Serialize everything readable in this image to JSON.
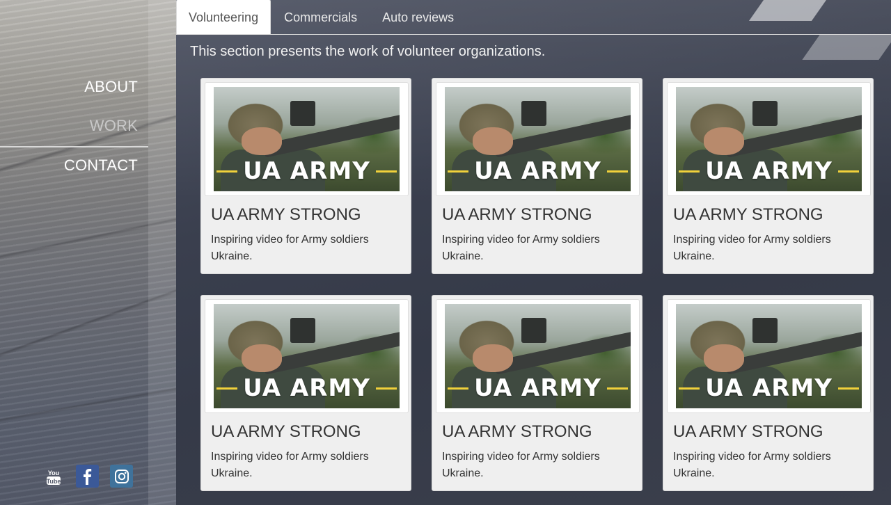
{
  "nav": {
    "about": "ABOUT",
    "work": "WORK",
    "contact": "CONTACT"
  },
  "socials": [
    "youtube-icon",
    "facebook-icon",
    "instagram-icon"
  ],
  "tabs": [
    {
      "label": "Volunteering",
      "active": true
    },
    {
      "label": "Commercials",
      "active": false
    },
    {
      "label": "Auto reviews",
      "active": false
    }
  ],
  "intro": "This section presents the work of volunteer organizations.",
  "cards": [
    {
      "overlay": "UA ARMY",
      "title": "UA ARMY STRONG",
      "description": "Inspiring video for Army soldiers Ukraine."
    },
    {
      "overlay": "UA ARMY",
      "title": "UA ARMY STRONG",
      "description": "Inspiring video for Army soldiers Ukraine."
    },
    {
      "overlay": "UA ARMY",
      "title": "UA ARMY STRONG",
      "description": "Inspiring video for Army soldiers Ukraine."
    },
    {
      "overlay": "UA ARMY",
      "title": "UA ARMY STRONG",
      "description": "Inspiring video for Army soldiers Ukraine."
    },
    {
      "overlay": "UA ARMY",
      "title": "UA ARMY STRONG",
      "description": "Inspiring video for Army soldiers Ukraine."
    },
    {
      "overlay": "UA ARMY",
      "title": "UA ARMY STRONG",
      "description": "Inspiring video for Army soldiers Ukraine."
    }
  ],
  "colors": {
    "accent_yellow": "#f1d13b",
    "facebook_blue": "#3b5998",
    "instagram_blue": "#3f729b"
  }
}
